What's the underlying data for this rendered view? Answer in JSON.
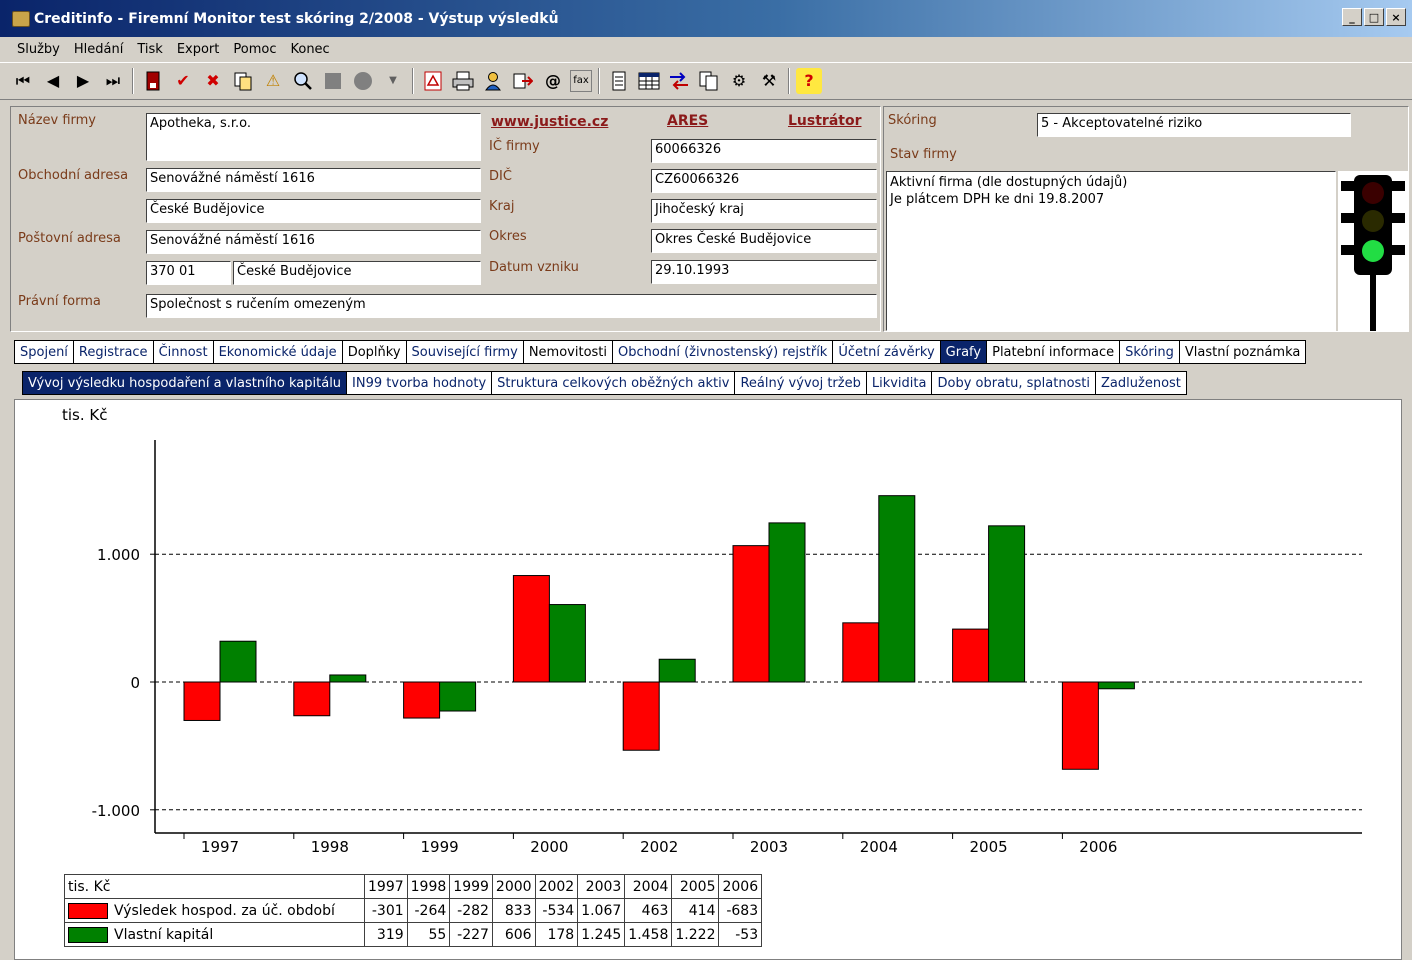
{
  "window": {
    "title": "Creditinfo - Firemní Monitor test skóring 2/2008 - Výstup výsledků",
    "btn_min": "_",
    "btn_max": "□",
    "btn_close": "×"
  },
  "menu": [
    "Služby",
    "Hledání",
    "Tisk",
    "Export",
    "Pomoc",
    "Konec"
  ],
  "toolbar_icons": [
    "first-icon",
    "prev-icon",
    "next-icon",
    "last-icon",
    "save-icon",
    "check-icon",
    "cross-icon",
    "copy-icon",
    "warning-icon",
    "search-icon",
    "stop-icon",
    "record-icon",
    "dropdown-icon",
    "pdf-icon",
    "print-icon",
    "user-icon",
    "export-icon",
    "email-icon",
    "fax-icon",
    "document-icon",
    "grid-icon",
    "transfer-icon",
    "copy-pages-icon",
    "settings-icon",
    "tools-icon",
    "help-icon"
  ],
  "company": {
    "name_label": "Název firmy",
    "name_value": "Apotheka, s.r.o.",
    "business_address_label": "Obchodní adresa",
    "business_street": "Senovážné náměstí 1616",
    "business_city": "České Budějovice",
    "postal_address_label": "Poštovní adresa",
    "postal_street": "Senovážné náměstí 1616",
    "postal_zip": "370 01",
    "postal_city": "České Budějovice",
    "legal_form_label": "Právní forma",
    "legal_form_value": "Společnost s ručením omezeným",
    "link_justice": "www.justice.cz",
    "link_ares": "ARES",
    "link_lustrator": "Lustrátor",
    "ic_label": "IČ firmy",
    "ic_value": "60066326",
    "dic_label": "DIČ",
    "dic_value": "CZ60066326",
    "kraj_label": "Kraj",
    "kraj_value": "Jihočeský kraj",
    "okres_label": "Okres",
    "okres_value": "Okres České Budějovice",
    "date_label": "Datum vzniku",
    "date_value": "29.10.1993"
  },
  "scoring": {
    "label": "Skóring",
    "value": "5 - Akceptovatelné riziko",
    "status_label": "Stav firmy",
    "status_line1": "Aktivní firma (dle dostupných údajů)",
    "status_line2": "Je plátcem DPH ke dni 19.8.2007",
    "traffic_light": "green"
  },
  "tabs": [
    "Spojení",
    "Registrace",
    "Činnost",
    "Ekonomické údaje",
    "Doplňky",
    "Související firmy",
    "Nemovitosti",
    "Obchodní (živnostenský) rejstřík",
    "Účetní závěrky",
    "Grafy",
    "Platební informace",
    "Skóring",
    "Vlastní poznámka"
  ],
  "active_tab": "Grafy",
  "subtabs": [
    "Vývoj výsledku hospodaření a vlastního kapitálu",
    "IN99 tvorba hodnoty",
    "Struktura celkových oběžných aktiv",
    "Reálný vývoj tržeb",
    "Likvidita",
    "Doby obratu, splatnosti",
    "Zadluženost"
  ],
  "active_subtab": "Vývoj výsledku hospodaření a vlastního kapitálu",
  "chart_data": {
    "type": "bar",
    "ylabel": "tis. Kč",
    "categories": [
      "1997",
      "1998",
      "1999",
      "2000",
      "2002",
      "2003",
      "2004",
      "2005",
      "2006"
    ],
    "series": [
      {
        "name": "Výsledek hospod. za úč. období",
        "color": "#ff0000",
        "values": [
          -301,
          -264,
          -282,
          833,
          -534,
          1067,
          463,
          414,
          -683
        ]
      },
      {
        "name": "Vlastní kapitál",
        "color": "#008000",
        "values": [
          319,
          55,
          -227,
          606,
          178,
          1245,
          1458,
          1222,
          -53
        ]
      }
    ],
    "ylim": [
      -1150,
      1800
    ],
    "yticks": [
      -1000,
      0,
      1000
    ],
    "ytick_labels": [
      "-1.000",
      "0",
      "1.000"
    ],
    "grid": "dashed horizontal at ticks",
    "table_header": "tis. Kč",
    "table": {
      "header": [
        "1997",
        "1998",
        "1999",
        "2000",
        "2002",
        "2003",
        "2004",
        "2005",
        "2006"
      ],
      "row1": [
        "-301",
        "-264",
        "-282",
        "833",
        "-534",
        "1.067",
        "463",
        "414",
        "-683"
      ],
      "row2": [
        "319",
        "55",
        "-227",
        "606",
        "178",
        "1.245",
        "1.458",
        "1.222",
        "-53"
      ]
    }
  }
}
